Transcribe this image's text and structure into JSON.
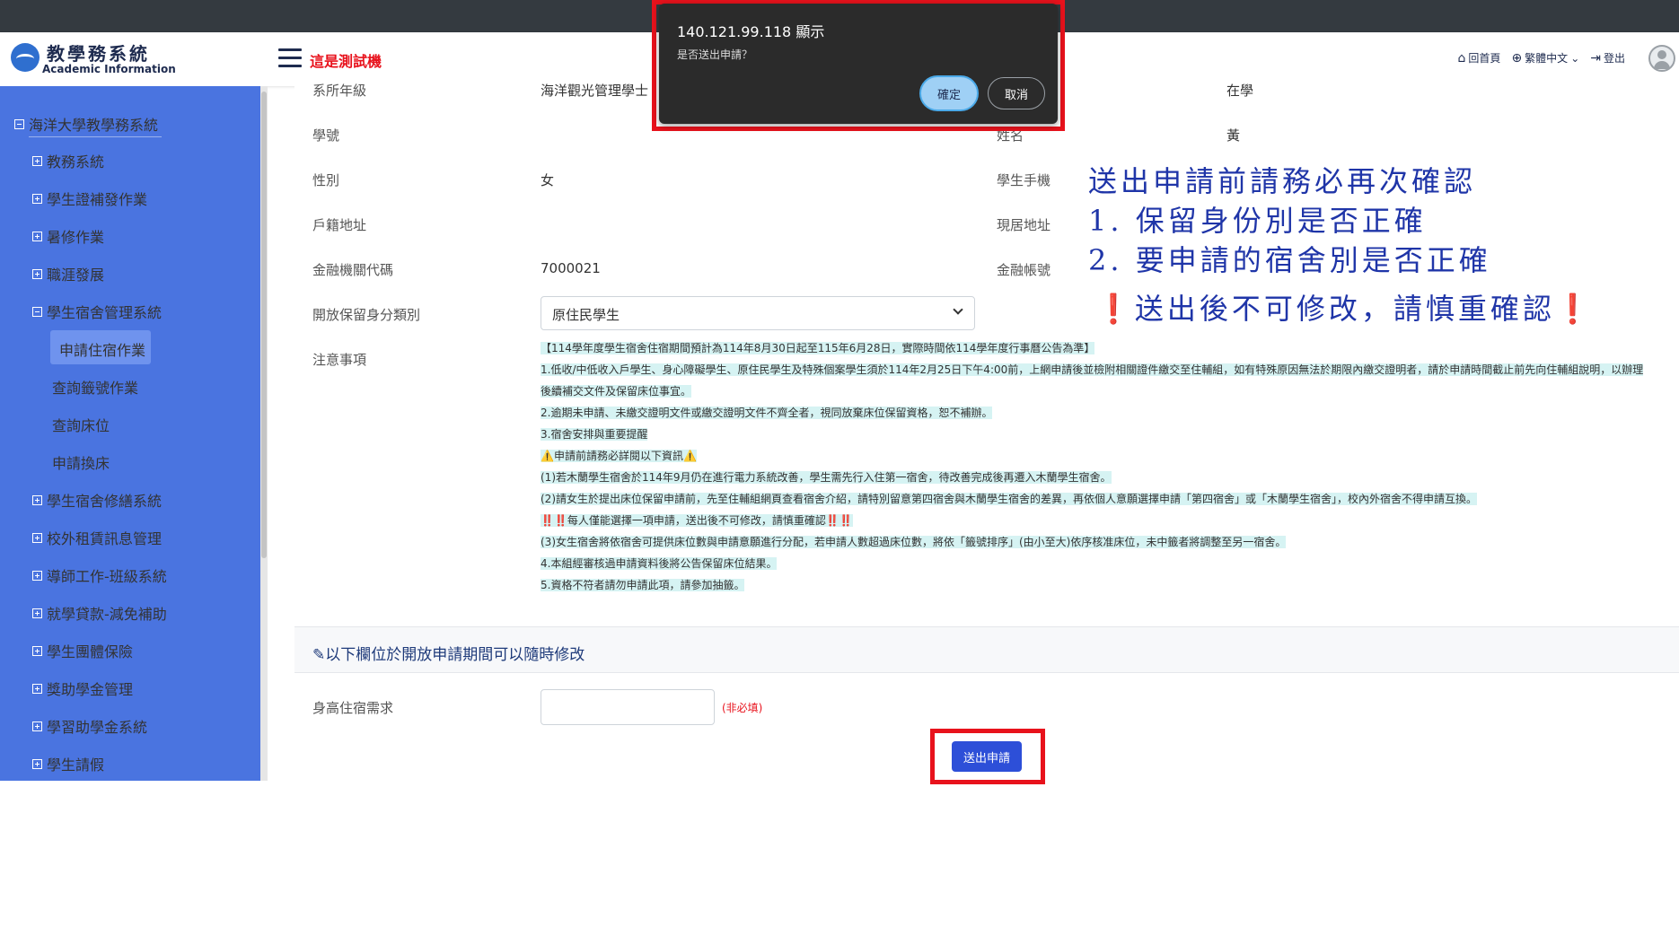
{
  "header": {
    "logo_cn": "教學務系統",
    "logo_en": "Academic Information",
    "test_label": "這是測試機",
    "links": [
      {
        "icon": "home-icon",
        "glyph": "⌂",
        "label": "回首頁"
      },
      {
        "icon": "globe-icon",
        "glyph": "⊕",
        "label": "繁體中文"
      },
      {
        "icon": "logout-icon",
        "glyph": "⇥",
        "label": "登出"
      }
    ]
  },
  "sidebar": {
    "root": "海洋大學教學務系統",
    "items": [
      {
        "label": "教務系統"
      },
      {
        "label": "學生證補發作業"
      },
      {
        "label": "暑修作業"
      },
      {
        "label": "職涯發展"
      },
      {
        "label": "學生宿舍管理系統"
      },
      {
        "label": "申請住宿作業"
      },
      {
        "label": "查詢籤號作業"
      },
      {
        "label": "查詢床位"
      },
      {
        "label": "申請換床"
      },
      {
        "label": "學生宿舍修繕系統"
      },
      {
        "label": "校外租賃訊息管理"
      },
      {
        "label": "導師工作-班級系統"
      },
      {
        "label": "就學貸款-減免補助"
      },
      {
        "label": "學生團體保險"
      },
      {
        "label": "獎助學金管理"
      },
      {
        "label": "學習助學金系統"
      },
      {
        "label": "學生請假"
      }
    ]
  },
  "form": {
    "dept_label": "系所年級",
    "dept_value": "海洋觀光管理學士",
    "status_value": "在學",
    "student_id_label": "學號",
    "name_label": "姓名",
    "name_value": "黃",
    "gender_label": "性別",
    "gender_value": "女",
    "mobile_label": "學生手機",
    "registered_addr_label": "戶籍地址",
    "current_addr_label": "現居地址",
    "bank_code_label": "金融機關代碼",
    "bank_code_value": "7000021",
    "bank_account_label": "金融帳號",
    "reserve_type_label": "開放保留身分類別",
    "reserve_type_value": "原住民學生",
    "notes_label": "注意事項"
  },
  "notes": [
    "【114學年度學生宿舍住宿期間預計為114年8月30日起至115年6月28日，實際時間依114學年度行事曆公告為準】",
    "1.低收/中低收入戶學生、身心障礙學生、原住民學生及特殊個案學生須於114年2月25日下午4:00前，上網申請後並檢附相關證件繳交至住輔組，如有特殊原因無法於期限內繳交證明者，請於申請時間截止前先向住輔組說明，以辦理後續補交文件及保留床位事宜。",
    "2.逾期未申請、未繳交證明文件或繳交證明文件不齊全者，視同放棄床位保留資格，恕不補辦。",
    "3.宿舍安排與重要提醒",
    "⚠️申請前請務必詳閱以下資訊⚠️",
    "(1)若木蘭學生宿舍於114年9月仍在進行電力系統改善，學生需先行入住第一宿舍，待改善完成後再遷入木蘭學生宿舍。",
    "(2)請女生於提出床位保留申請前，先至住輔組網頁查看宿舍介紹，請特別留意第四宿舍與木蘭學生宿舍的差異，再依個人意願選擇申請「第四宿舍」或「木蘭學生宿舍」，校內外宿舍不得申請互換。",
    "‼️‼️每人僅能選擇一項申請，送出後不可修改，請慎重確認‼️‼️",
    "(3)女生宿舍將依宿舍可提供床位數與申請意願進行分配，若申請人數超過床位數，將依「籤號排序」(由小至大)依序核准床位，未中籤者將調整至另一宿舍。",
    "4.本組經審核過申請資料後將公告保留床位結果。",
    "5.資格不符者請勿申請此項，請參加抽籤。"
  ],
  "annotation": {
    "line1": "送出申請前請務必再次確認",
    "line2": "1. 保留身份別是否正確",
    "line3": "2. 要申請的宿舍別是否正確",
    "line4": "❗送出後不可修改，請慎重確認❗"
  },
  "editable_section": {
    "title": "以下欄位於開放申請期間可以隨時修改",
    "height_label": "身高住宿需求",
    "optional_hint": "(非必填)",
    "submit_label": "送出申請"
  },
  "dialog": {
    "title": "140.121.99.118 顯示",
    "message": "是否送出申請？",
    "ok_label": "確定",
    "cancel_label": "取消"
  },
  "colors": {
    "sidebar": "#4a74e0",
    "accent_red": "#e8121c",
    "submit_blue": "#2d4fd8",
    "annotation_blue": "#1f35a8"
  }
}
